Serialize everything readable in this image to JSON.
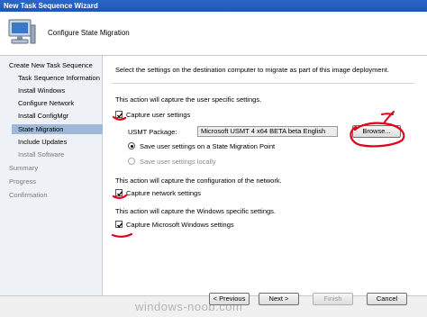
{
  "window": {
    "title": "New Task Sequence Wizard"
  },
  "header": {
    "title": "Configure State Migration",
    "icon": "computer-icon"
  },
  "nav": {
    "items": [
      {
        "label": "Create New Task Sequence",
        "state": "normal"
      },
      {
        "label": "Task Sequence Information",
        "state": "normal"
      },
      {
        "label": "Install Windows",
        "state": "normal"
      },
      {
        "label": "Configure Network",
        "state": "normal"
      },
      {
        "label": "Install ConfigMgr",
        "state": "normal"
      },
      {
        "label": "State Migration",
        "state": "active"
      },
      {
        "label": "Include Updates",
        "state": "normal"
      },
      {
        "label": "Install Software",
        "state": "normal"
      },
      {
        "label": "Summary",
        "state": "dim"
      },
      {
        "label": "Progress",
        "state": "dim"
      },
      {
        "label": "Confirmation",
        "state": "dim"
      }
    ]
  },
  "main": {
    "intro": "Select the settings on the destination computer to migrate as part of this image deployment.",
    "user": {
      "description": "This action will capture the user specific settings.",
      "checkbox_label": "Capture user settings",
      "checked": true,
      "package_label": "USMT Package:",
      "package_value": "Microsoft USMT 4 x64 BETA beta English",
      "browse_label": "Browse...",
      "radio_smp_label": "Save user settings on a State Migration Point",
      "radio_local_label": "Save user settings locally"
    },
    "network": {
      "description": "This action will capture the configuration of the network.",
      "checkbox_label": "Capture network settings",
      "checked": true
    },
    "windows": {
      "description": "This action will capture the Windows specific settings.",
      "checkbox_label": "Capture Microsoft Windows settings",
      "checked": true
    }
  },
  "footer": {
    "previous_label": "< Previous",
    "next_label": "Next >",
    "finish_label": "Finish",
    "cancel_label": "Cancel"
  },
  "watermark": "windows-noob.com",
  "colors": {
    "annotation": "#e2001a",
    "titlebar": "#1e56b4",
    "nav_active": "#9fb7d8"
  }
}
